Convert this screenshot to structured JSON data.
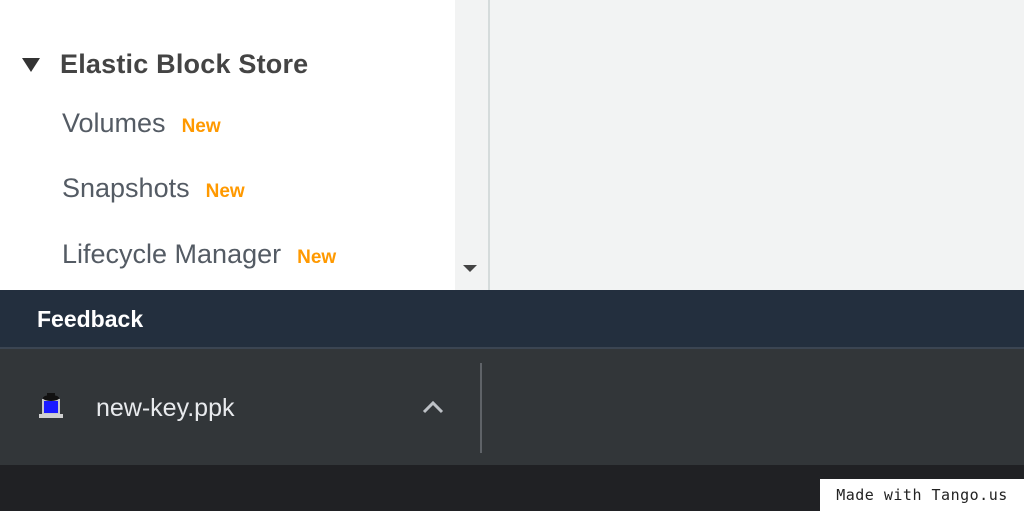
{
  "sidebar": {
    "section_title": "Elastic Block Store",
    "items": [
      {
        "label": "Volumes",
        "badge": "New"
      },
      {
        "label": "Snapshots",
        "badge": "New"
      },
      {
        "label": "Lifecycle Manager",
        "badge": "New"
      }
    ]
  },
  "feedback": {
    "label": "Feedback"
  },
  "download_shelf": {
    "file_name": "new-key.ppk",
    "file_icon": "ppk-key-file-icon",
    "expand_icon": "chevron-up-icon"
  },
  "watermark": {
    "text": "Made with Tango.us"
  },
  "colors": {
    "badge": "#ff9900",
    "feedback_bar": "#232f3e",
    "download_shelf": "#323639"
  }
}
